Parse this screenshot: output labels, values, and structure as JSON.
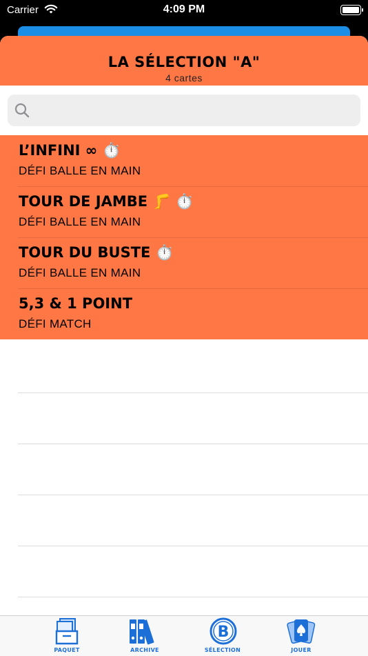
{
  "status_bar": {
    "carrier": "Carrier",
    "time": "4:09 PM"
  },
  "header": {
    "title": "LA SÉLECTION \"A\"",
    "subtitle": "4 cartes"
  },
  "search": {
    "placeholder": ""
  },
  "cards": [
    {
      "title": "L’INFINI ∞ ⏱️",
      "subtitle": "DÉFI BALLE EN MAIN"
    },
    {
      "title": "TOUR DE JAMBE 🦵 ⏱️",
      "subtitle": "DÉFI BALLE EN MAIN"
    },
    {
      "title": "TOUR DU BUSTE ⏱️",
      "subtitle": "DÉFI BALLE EN MAIN"
    },
    {
      "title": "5,3 & 1 POINT",
      "subtitle": "DÉFI MATCH"
    }
  ],
  "tabs": [
    {
      "label": "PAQUET",
      "icon": "box-icon"
    },
    {
      "label": "ARCHIVE",
      "icon": "binders-icon"
    },
    {
      "label": "SÉLECTION",
      "icon": "b-circle-icon"
    },
    {
      "label": "JOUER",
      "icon": "playing-cards-icon"
    }
  ],
  "colors": {
    "header": "#ff7744",
    "accent": "#1d6fd8",
    "strip": "#1d8ee6"
  }
}
